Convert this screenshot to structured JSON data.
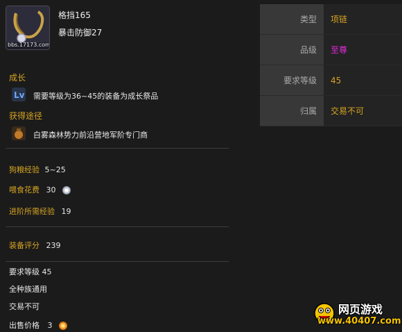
{
  "item": {
    "watermark": "bbs.17173.com",
    "stats": [
      "格挡165",
      "暴击防御27"
    ]
  },
  "growth": {
    "heading": "成长",
    "text": "需要等级为36~45的装备为成长祭品"
  },
  "source": {
    "heading": "获得途径",
    "text": "白雾森林势力前沿营地军阶专门商"
  },
  "pet": {
    "exp_label": "狗粮经验",
    "exp_value": "5~25",
    "feed_label": "喂食花费",
    "feed_value": "30",
    "advance_label": "进阶所需经验",
    "advance_value": "19"
  },
  "rating": {
    "label": "装备评分",
    "value": "239"
  },
  "requirements": {
    "level": "要求等级  45",
    "race": "全种族通用",
    "trade": "交易不可",
    "sell_label": "出售价格",
    "sell_value": "3"
  },
  "info_table": [
    {
      "key": "类型",
      "value": "项链"
    },
    {
      "key": "品级",
      "value": "至尊"
    },
    {
      "key": "要求等级",
      "value": "45"
    },
    {
      "key": "归属",
      "value": "交易不可"
    }
  ],
  "brand": {
    "text1": "网页游戏",
    "text2": "www.40407.com"
  },
  "colors": {
    "gold": "#d6a423",
    "quality_pink": "#e02ad8"
  }
}
